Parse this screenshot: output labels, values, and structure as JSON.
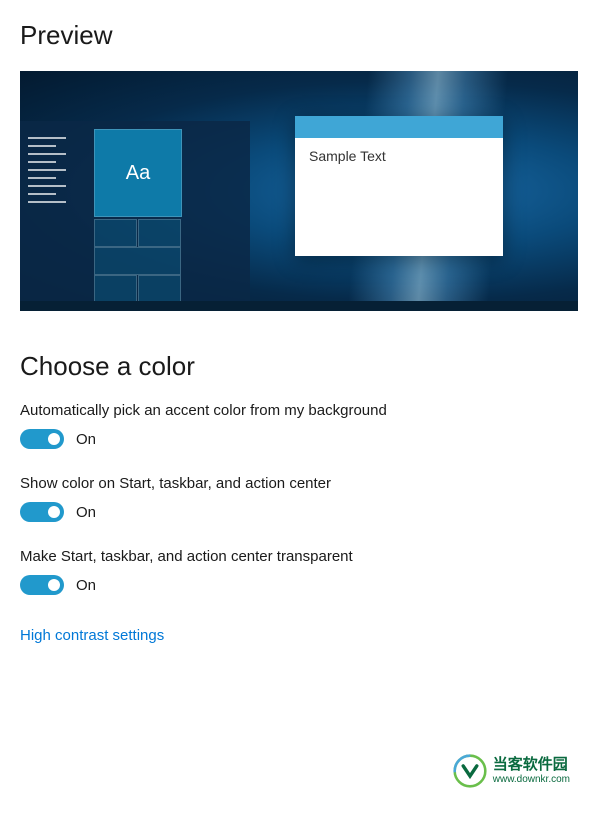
{
  "headings": {
    "preview": "Preview",
    "choose_color": "Choose a color"
  },
  "preview": {
    "sample_text": "Sample Text",
    "tile_text": "Aa"
  },
  "settings": {
    "auto_accent": {
      "label": "Automatically pick an accent color from my background",
      "state": "On"
    },
    "show_color": {
      "label": "Show color on Start, taskbar, and action center",
      "state": "On"
    },
    "transparent": {
      "label": "Make Start, taskbar, and action center transparent",
      "state": "On"
    }
  },
  "links": {
    "high_contrast": "High contrast settings"
  },
  "watermark": {
    "name": "当客软件园",
    "url": "www.downkr.com"
  }
}
